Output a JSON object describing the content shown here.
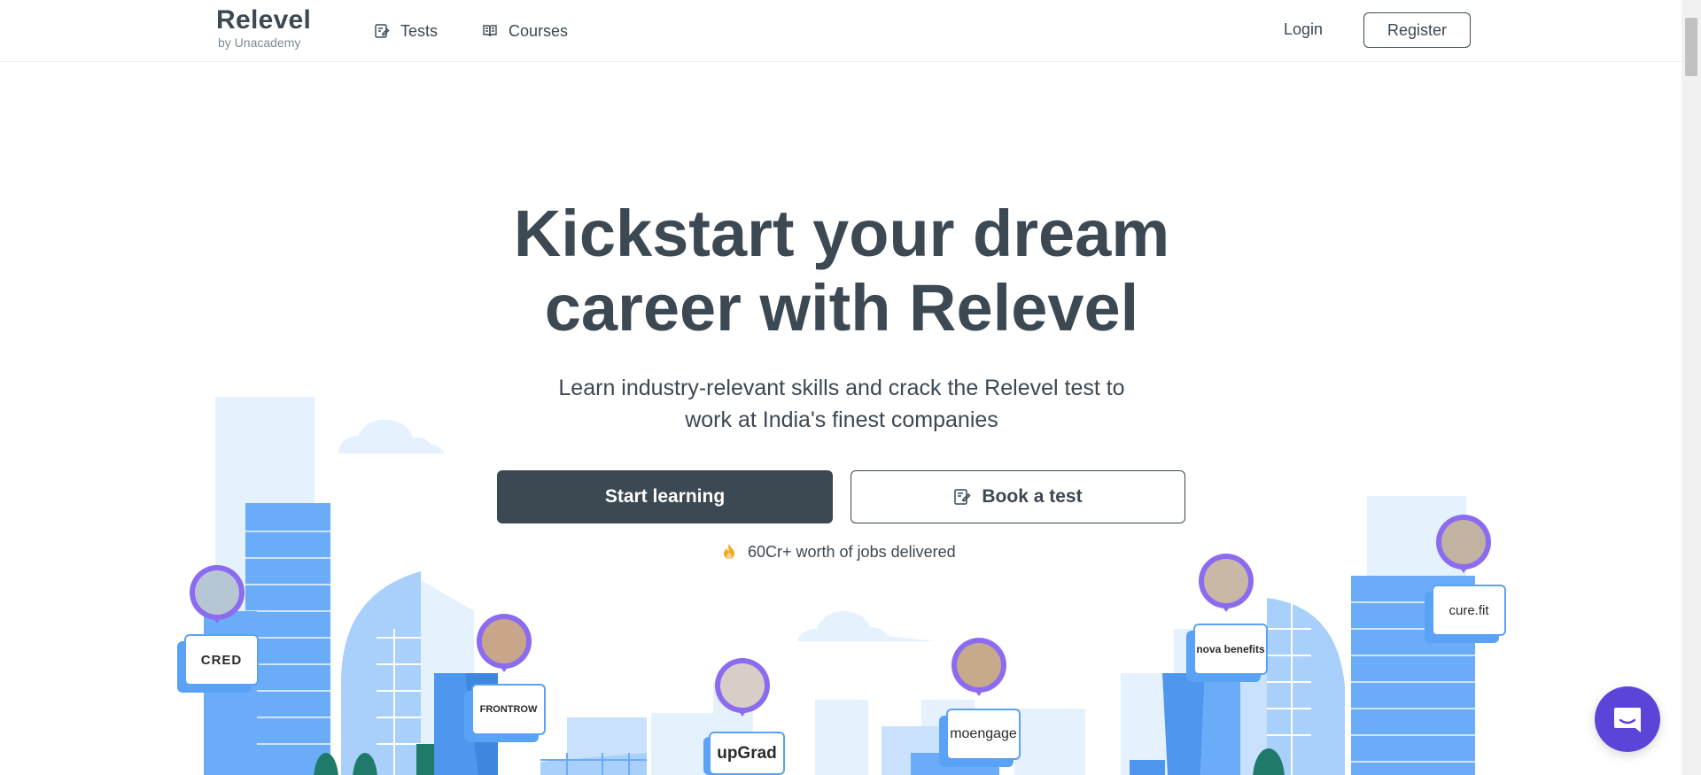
{
  "header": {
    "brand": "Relevel",
    "brand_sub": "by Unacademy",
    "nav": [
      {
        "label": "Tests",
        "icon": "edit-note-icon"
      },
      {
        "label": "Courses",
        "icon": "book-icon"
      }
    ],
    "login_label": "Login",
    "register_label": "Register"
  },
  "hero": {
    "title_line1": "Kickstart your dream",
    "title_line2": "career with Relevel",
    "subtitle_line1": "Learn industry-relevant skills and crack the Relevel test to",
    "subtitle_line2": "work at India's finest companies",
    "start_button": "Start learning",
    "book_button": "Book a test",
    "stat_text": "60Cr+ worth of jobs delivered"
  },
  "companies": [
    {
      "name": "CRED"
    },
    {
      "name": "FRONTROW"
    },
    {
      "name": "upGrad"
    },
    {
      "name": "moengage"
    },
    {
      "name": "nova benefits"
    },
    {
      "name": "cure.fit"
    }
  ],
  "colors": {
    "primary": "#3c4852",
    "accent_blue": "#5aa2f5",
    "light_blue": "#a9d0fb",
    "pale_blue": "#e5f1fd",
    "avatar_ring": "#8b6cf0",
    "chat": "#5b45d9",
    "flame": "#f5a623"
  }
}
